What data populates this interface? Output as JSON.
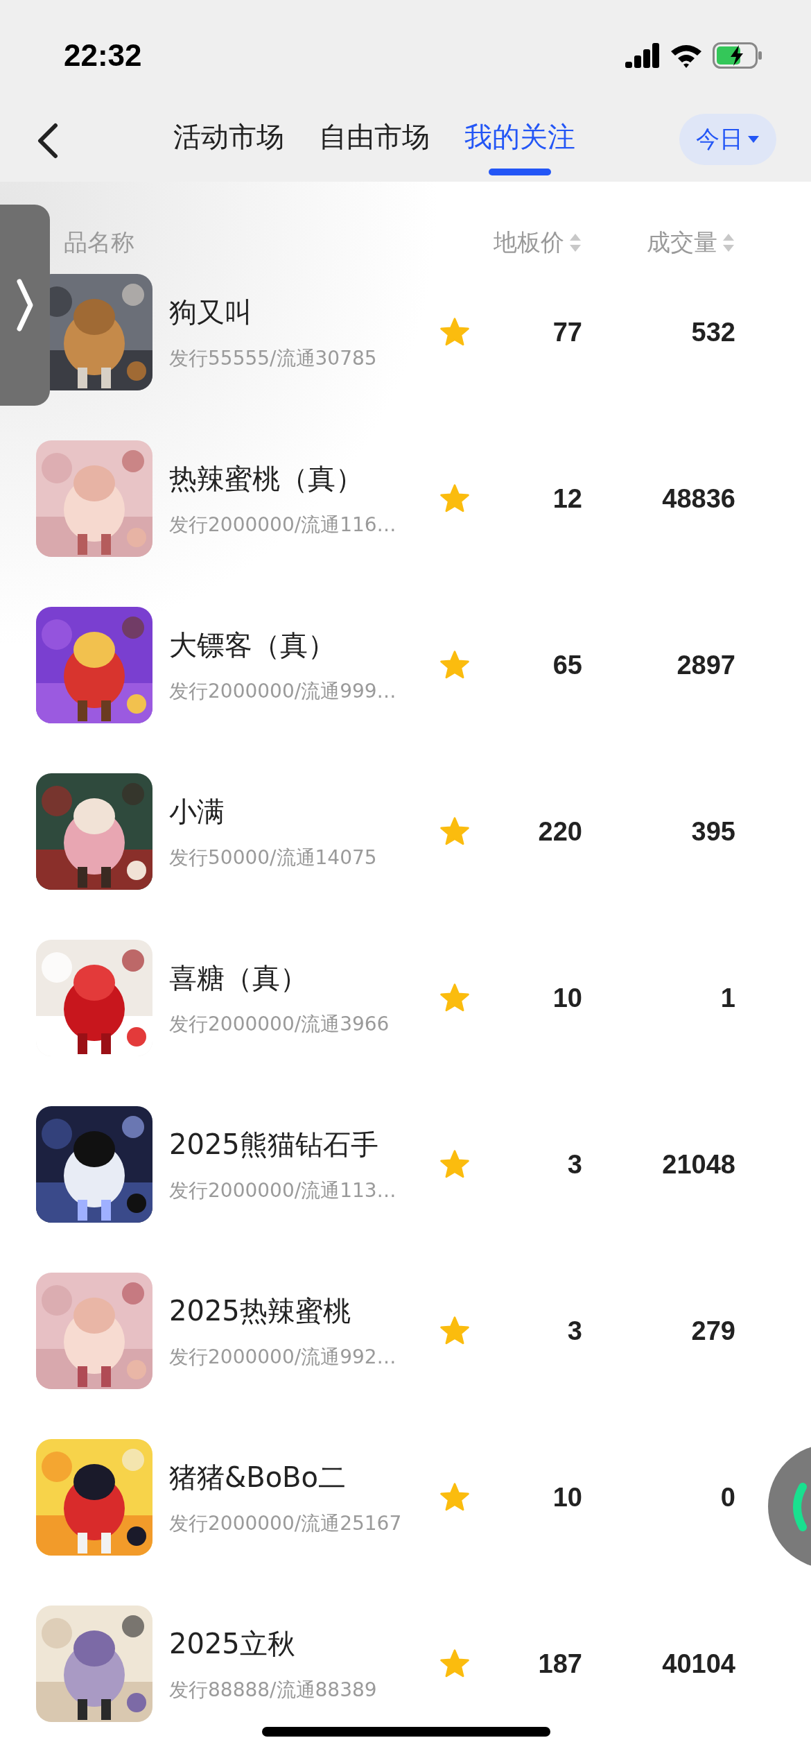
{
  "status_bar": {
    "time": "22:32"
  },
  "nav": {
    "tabs": [
      {
        "label": "活动市场",
        "selected": false
      },
      {
        "label": "自由市场",
        "selected": false
      },
      {
        "label": "我的关注",
        "selected": true
      }
    ],
    "period": "今日"
  },
  "table": {
    "columns": [
      {
        "label": "品名称",
        "sortable": false
      },
      {
        "label": "地板价",
        "sortable": true
      },
      {
        "label": "成交量",
        "sortable": true
      }
    ],
    "rows": [
      {
        "name": "狗又叫",
        "supply": "发行55555/流通30785",
        "starred": true,
        "floor_price": "77",
        "volume": "532"
      },
      {
        "name": "热辣蜜桃（真）",
        "supply": "发行2000000/流通116…",
        "starred": true,
        "floor_price": "12",
        "volume": "48836"
      },
      {
        "name": "大镖客（真）",
        "supply": "发行2000000/流通999…",
        "starred": true,
        "floor_price": "65",
        "volume": "2897"
      },
      {
        "name": "小满",
        "supply": "发行50000/流通14075",
        "starred": true,
        "floor_price": "220",
        "volume": "395"
      },
      {
        "name": "喜糖（真）",
        "supply": "发行2000000/流通3966",
        "starred": true,
        "floor_price": "10",
        "volume": "1"
      },
      {
        "name": "2025熊猫钻石手",
        "supply": "发行2000000/流通113…",
        "starred": true,
        "floor_price": "3",
        "volume": "21048"
      },
      {
        "name": "2025热辣蜜桃",
        "supply": "发行2000000/流通992…",
        "starred": true,
        "floor_price": "3",
        "volume": "279"
      },
      {
        "name": "猪猪&BoBo二",
        "supply": "发行2000000/流通25167",
        "starred": true,
        "floor_price": "10",
        "volume": "0"
      },
      {
        "name": "2025立秋",
        "supply": "发行88888/流通88389",
        "starred": true,
        "floor_price": "187",
        "volume": "40104"
      }
    ]
  }
}
